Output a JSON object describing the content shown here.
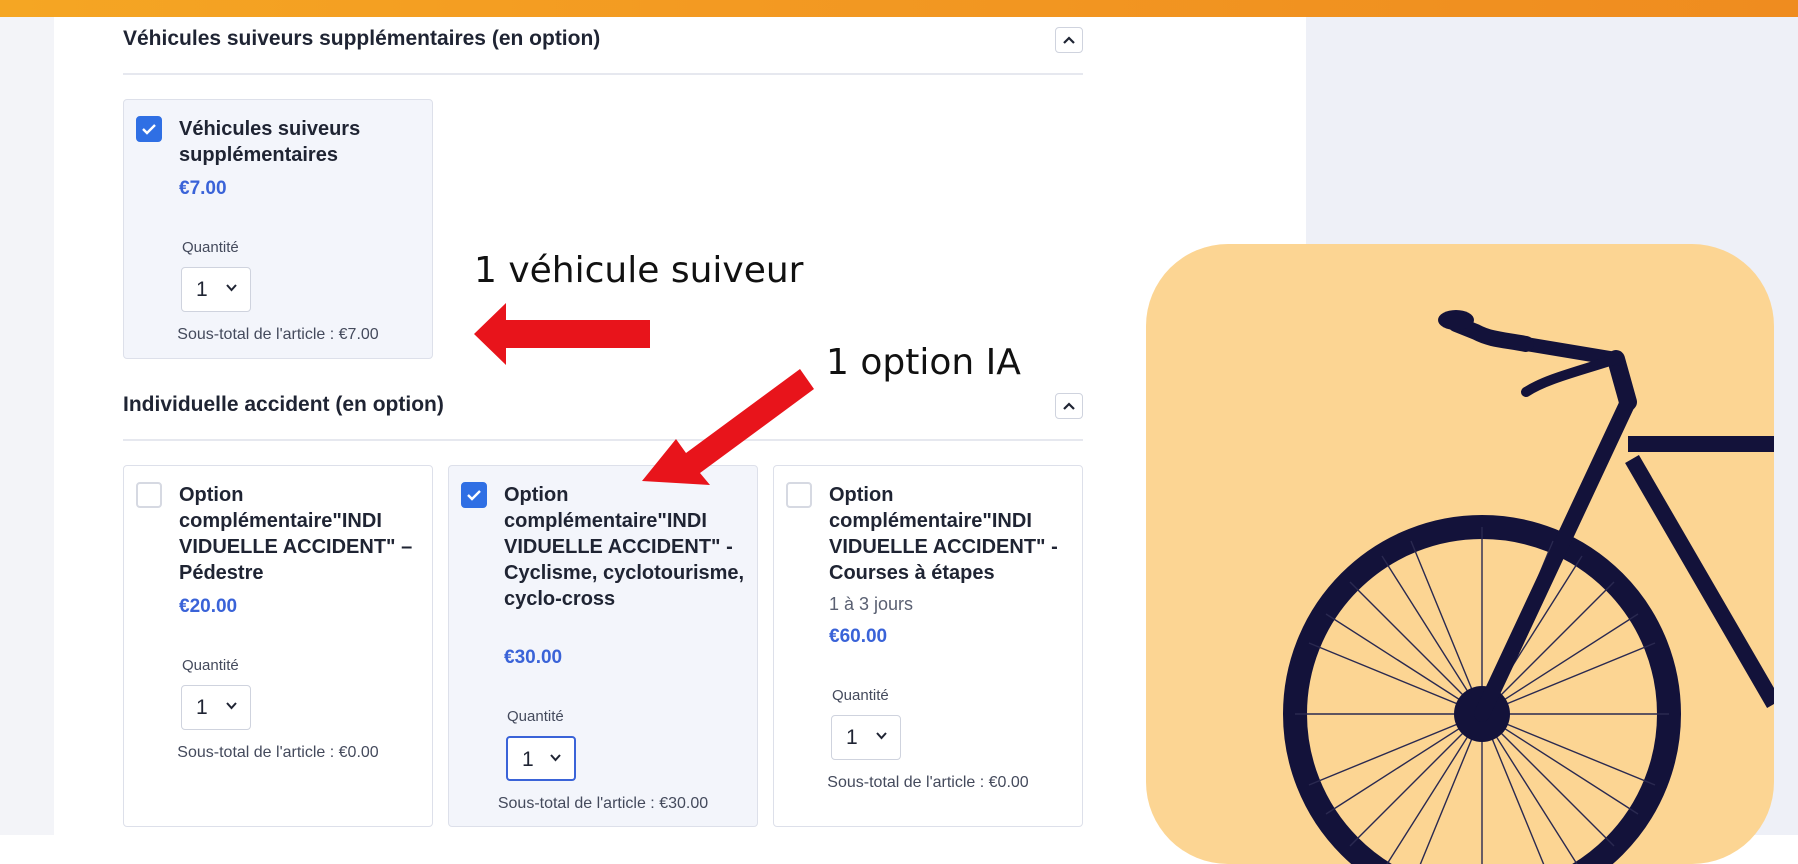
{
  "section1": {
    "title": "Véhicules suiveurs supplémentaires (en option)",
    "card": {
      "checked": true,
      "title": "Véhicules suiveurs supplémentaires",
      "price": "€7.00",
      "qty_label": "Quantité",
      "qty_value": "1",
      "subtotal": "Sous-total de l'article : €7.00"
    }
  },
  "section2": {
    "title": "Individuelle accident (en option)",
    "cards": [
      {
        "checked": false,
        "title": "Option complémentaire\"INDI VIDUELLE ACCIDENT\" – Pédestre",
        "price": "€20.00",
        "qty_label": "Quantité",
        "qty_value": "1",
        "subtotal": "Sous-total de l'article : €0.00"
      },
      {
        "checked": true,
        "title": "Option complémentaire\"INDI VIDUELLE ACCIDENT\" - Cyclisme, cyclotourisme, cyclo-cross",
        "price": "€30.00",
        "qty_label": "Quantité",
        "qty_value": "1",
        "subtotal": "Sous-total de l'article : €30.00"
      },
      {
        "checked": false,
        "title": "Option complémentaire\"INDI VIDUELLE ACCIDENT\" - Courses à étapes",
        "subtitle": "1 à 3 jours",
        "price": "€60.00",
        "qty_label": "Quantité",
        "qty_value": "1",
        "subtotal": "Sous-total de l'article : €0.00"
      }
    ]
  },
  "annotations": {
    "vehicle_note": "1 véhicule suiveur",
    "ia_note": "1 option IA"
  },
  "icons": {
    "collapse": "chevron-up-icon",
    "dropdown": "chevron-down-icon",
    "check": "check-icon",
    "illustration": "bicycle-illustration"
  },
  "colors": {
    "accent": "#2f6fe4",
    "price": "#3a63d8",
    "topbar": "#f39a22",
    "illustration_bg": "#fcd593",
    "arrow": "#e8141b"
  }
}
